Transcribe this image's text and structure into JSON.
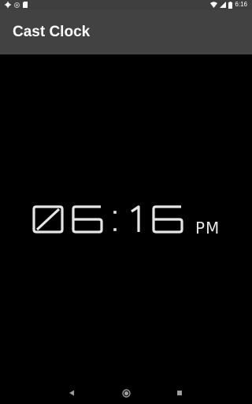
{
  "status_bar": {
    "time": "6:16",
    "icons_left": [
      "settings-icon",
      "circle-icon",
      "sd-card-icon"
    ],
    "icons_right": [
      "wifi-icon",
      "cell-signal-icon",
      "battery-icon"
    ]
  },
  "app_bar": {
    "title": "Cast Clock"
  },
  "clock": {
    "hours": "06",
    "minutes": "16",
    "separator": ":",
    "period": "PM",
    "color": "#e6e6e6"
  },
  "nav_bar": {
    "buttons": [
      "back-icon",
      "home-icon",
      "recents-icon"
    ]
  },
  "colors": {
    "status_bar": "#3f3f3f",
    "app_bar": "#424242",
    "background": "#000000",
    "text": "#ffffff"
  }
}
